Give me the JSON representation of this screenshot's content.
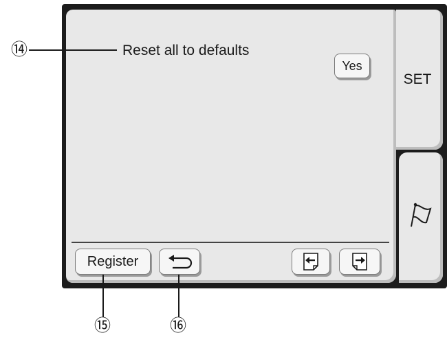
{
  "setting": {
    "label": "Reset all to defaults",
    "action_label": "Yes"
  },
  "tabs": {
    "set_label": "SET",
    "flag_icon": "flag-icon"
  },
  "bottom_bar": {
    "register_label": "Register",
    "back_icon": "return-arrow-icon",
    "prev_icon": "page-prev-icon",
    "next_icon": "page-next-icon"
  },
  "callouts": {
    "c14": "⑭",
    "c15": "⑮",
    "c16": "⑯"
  }
}
